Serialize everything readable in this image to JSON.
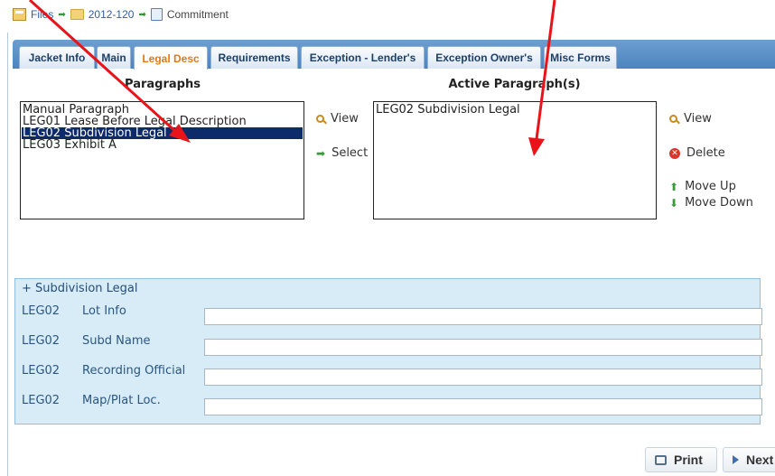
{
  "breadcrumb": {
    "items": [
      "Files",
      "2012-120",
      "Commitment"
    ]
  },
  "tabs": [
    "Jacket Info",
    "Main",
    "Legal Desc",
    "Requirements",
    "Exception - Lender's",
    "Exception Owner's",
    "Misc Forms"
  ],
  "active_tab": "Legal Desc",
  "paragraphs": {
    "heading": "Paragraphs",
    "items": [
      "Manual Paragraph",
      "LEG01 Lease Before Legal Description",
      "LEG02 Subdivision Legal",
      "LEG03 Exhibit A"
    ],
    "selected": "LEG02 Subdivision Legal"
  },
  "middle_actions": {
    "view": "View",
    "select": "Select"
  },
  "active_paragraphs": {
    "heading": "Active Paragraph(s)",
    "items": [
      "LEG02 Subdivision Legal"
    ]
  },
  "right_actions": {
    "view": "View",
    "delete": "Delete",
    "move_up": "Move Up",
    "move_down": "Move Down"
  },
  "subdivision": {
    "title": "+ Subdivision Legal",
    "rows": [
      {
        "code": "LEG02",
        "label": "Lot Info",
        "value": ""
      },
      {
        "code": "LEG02",
        "label": "Subd Name",
        "value": ""
      },
      {
        "code": "LEG02",
        "label": "Recording Official",
        "value": ""
      },
      {
        "code": "LEG02",
        "label": "Map/Plat Loc.",
        "value": ""
      }
    ]
  },
  "buttons": {
    "print": "Print",
    "next": "Next"
  },
  "colors": {
    "annotation_arrow": "#e8141a",
    "tab_bar": "#4d84bf",
    "active_tab_text": "#e07a18",
    "selection": "#0d2a6b"
  }
}
